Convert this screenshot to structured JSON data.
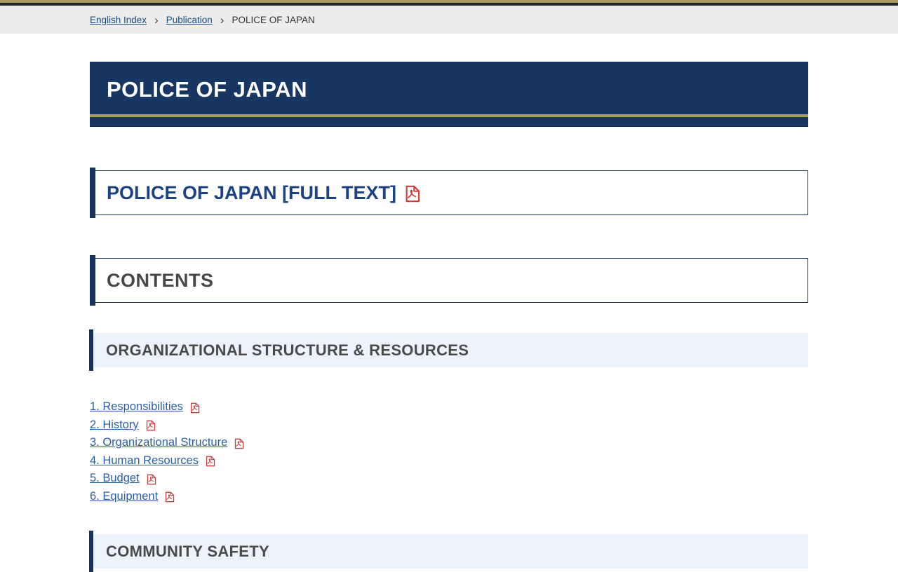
{
  "breadcrumb": {
    "english_index": "English Index",
    "separator": "›",
    "publication": "Publication",
    "current": "POLICE OF JAPAN"
  },
  "banner": {
    "title": "POLICE OF JAPAN"
  },
  "fulltext": {
    "label": "POLICE OF JAPAN [FULL TEXT]",
    "icon": "pdf-file-icon"
  },
  "contents": {
    "heading": "CONTENTS"
  },
  "sections": [
    {
      "title": "ORGANIZATIONAL STRUCTURE & RESOURCES"
    },
    {
      "title": "COMMUNITY SAFETY"
    }
  ],
  "toc": {
    "links": [
      {
        "label": "1. Responsibilities",
        "icon": "pdf-file-icon"
      },
      {
        "label": "2. History",
        "icon": "pdf-file-icon"
      },
      {
        "label": "3. Organizational Structure",
        "icon": "pdf-file-icon"
      },
      {
        "label": "4. Human Resources",
        "icon": "pdf-file-icon"
      },
      {
        "label": "5. Budget",
        "icon": "pdf-file-icon"
      },
      {
        "label": "6. Equipment",
        "icon": "pdf-file-icon"
      }
    ]
  },
  "colors": {
    "navy": "#16335e",
    "gold": "#a89b63",
    "link_blue": "#2b5fa5",
    "heading_link_blue": "#1d4283",
    "section_bg": "#ecf3fb",
    "pdf_red": "#d43a3a",
    "breadcrumb_bg": "#ededed"
  }
}
